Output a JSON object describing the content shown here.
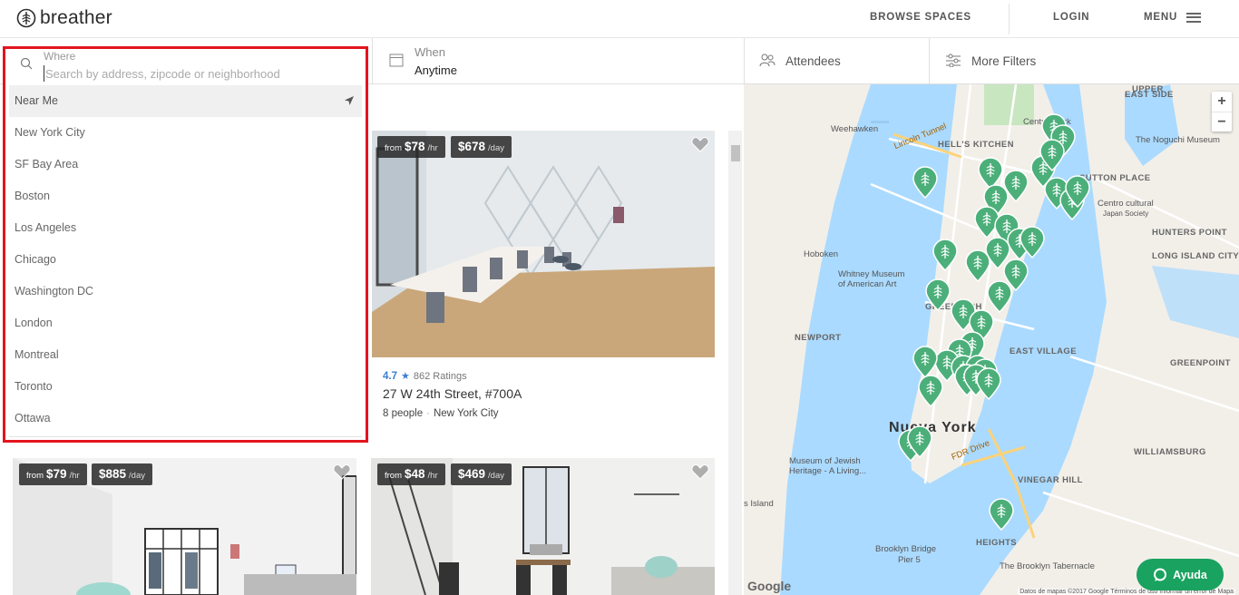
{
  "header": {
    "logo_text": "breather",
    "nav": {
      "browse": "BROWSE SPACES",
      "login": "LOGIN",
      "menu": "MENU"
    }
  },
  "filters": {
    "when": {
      "label": "When",
      "value": "Anytime"
    },
    "attendees": "Attendees",
    "more_filters": "More Filters"
  },
  "where": {
    "label": "Where",
    "placeholder": "Search by address, zipcode or neighborhood",
    "cities": [
      "Near Me",
      "New York City",
      "SF Bay Area",
      "Boston",
      "Los Angeles",
      "Chicago",
      "Washington DC",
      "London",
      "Montreal",
      "Toronto",
      "Ottawa"
    ]
  },
  "listings": [
    {
      "hourly_prefix": "from",
      "hourly": "$78",
      "hourly_unit": "/hr",
      "daily": "$678",
      "daily_unit": "/day",
      "rating": "4.7",
      "rating_count": "862 Ratings",
      "address": "27 W 24th Street, #700A",
      "capacity": "8 people",
      "city": "New York City"
    },
    {
      "hourly_prefix": "from",
      "hourly": "$79",
      "hourly_unit": "/hr",
      "daily": "$885",
      "daily_unit": "/day"
    },
    {
      "hourly_prefix": "from",
      "hourly": "$48",
      "hourly_unit": "/hr",
      "daily": "$469",
      "daily_unit": "/day"
    }
  ],
  "map": {
    "labels": {
      "weehawken": "Weehawken",
      "hells_kitchen": "HELL'S KITCHEN",
      "central_park": "Central Park",
      "upper_east": "UPPER",
      "east_side": "EAST SIDE",
      "noguchi": "The Noguchi Museum",
      "sutton": "SUTTON PLACE",
      "centro": "Centro cultural",
      "japan": "Japan Society",
      "hunters": "HUNTERS POINT",
      "long_island": "LONG ISLAND CITY",
      "hoboken": "Hoboken",
      "whitney": "Whitney Museum",
      "whitney2": "of American Art",
      "greenwich": "GREENWICH",
      "newport": "NEWPORT",
      "east_village": "EAST VILLAGE",
      "greenpoint": "GREENPOINT",
      "nueva_york": "Nueva York",
      "williamsburg": "WILLIAMSBURG",
      "vinegar": "VINEGAR HILL",
      "jewish": "Museum of Jewish",
      "jewish2": "Heritage - A Living...",
      "brooklyn_bridge": "Brooklyn Bridge",
      "pier": "Pier 5",
      "tabernacle": "The Brooklyn Tabernacle",
      "lincoln_tunnel": "Lincoln Tunnel",
      "heights": "HEIGHTS",
      "island": "s Island",
      "fdr": "FDR Drive"
    },
    "attribution": "Datos de mapas ©2017 Google  Términos de uso  Informar un error de Mapa",
    "google": "Google",
    "zoom_in": "+",
    "zoom_out": "−"
  },
  "help": {
    "label": "Ayuda"
  },
  "colors": {
    "accent": "#1aa260",
    "pin": "#4caf7a",
    "highlight": "#e3141e",
    "rating": "#3b7fcf"
  }
}
